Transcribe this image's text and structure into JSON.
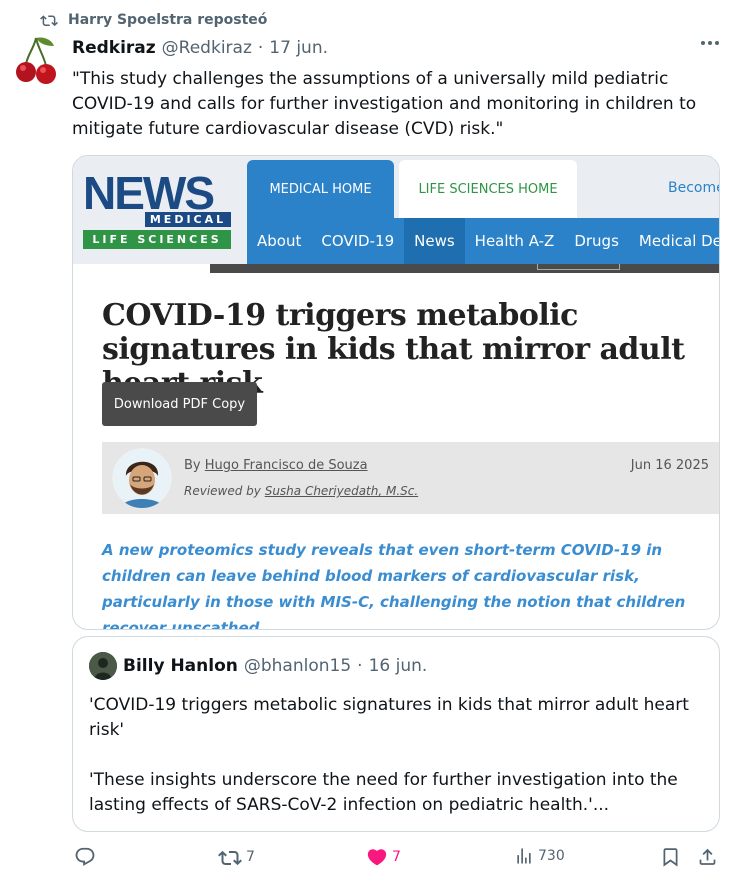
{
  "repost": {
    "label": "Harry Spoelstra reposteó",
    "icon": "repost-icon"
  },
  "tweet": {
    "name": "Redkiraz",
    "handle": "@Redkiraz",
    "separator": "·",
    "date": "17 jun.",
    "text": "\"This study challenges the assumptions of a universally mild pediatric COVID-19 and calls for further investigation and monitoring in children to mitigate future cardiovascular disease (CVD) risk.\""
  },
  "card": {
    "logo": {
      "news": "NEWS",
      "medical": "MEDICAL",
      "life": "LIFE SCIENCES"
    },
    "tabs": {
      "medical_home": "MEDICAL HOME",
      "life_home": "LIFE SCIENCES HOME",
      "become": "Become"
    },
    "nav": [
      "About",
      "COVID-19",
      "News",
      "Health A-Z",
      "Drugs",
      "Medical De"
    ],
    "headline": "COVID-19 triggers metabolic signatures in kids that mirror adult heart risk",
    "pdf_button": "Download PDF Copy",
    "by_prefix": "By ",
    "author": "Hugo Francisco de Souza",
    "reviewed_prefix": "Reviewed by ",
    "reviewer": "Susha Cheriyedath, M.Sc.",
    "pub_date": "Jun 16 2025",
    "summary": "A new proteomics study reveals that even short-term COVID-19 in children can leave behind blood markers of cardiovascular risk, particularly in those with MIS-C, challenging the notion that children recover unscathed.",
    "colors": {
      "brand_blue": "#1c4a84",
      "nav_blue": "#2b82c9",
      "brand_green": "#2f9446",
      "summary_blue": "#3a8dd1"
    }
  },
  "quote": {
    "name": "Billy Hanlon",
    "handle": "@bhanlon15",
    "separator": "·",
    "date": "16 jun.",
    "para1": "'COVID-19 triggers metabolic signatures in kids that mirror adult heart risk'",
    "para2": "'These insights underscore the need for further investigation into the lasting effects of SARS-CoV-2 infection on pediatric health.'..."
  },
  "actions": {
    "reply": {
      "icon": "reply-icon",
      "count": ""
    },
    "repost": {
      "icon": "repost-icon",
      "count": "7"
    },
    "like": {
      "icon": "heart-icon",
      "count": "7",
      "color": "#f91880"
    },
    "views": {
      "icon": "views-icon",
      "count": "730"
    },
    "bookmark": {
      "icon": "bookmark-icon"
    },
    "share": {
      "icon": "share-icon"
    }
  }
}
